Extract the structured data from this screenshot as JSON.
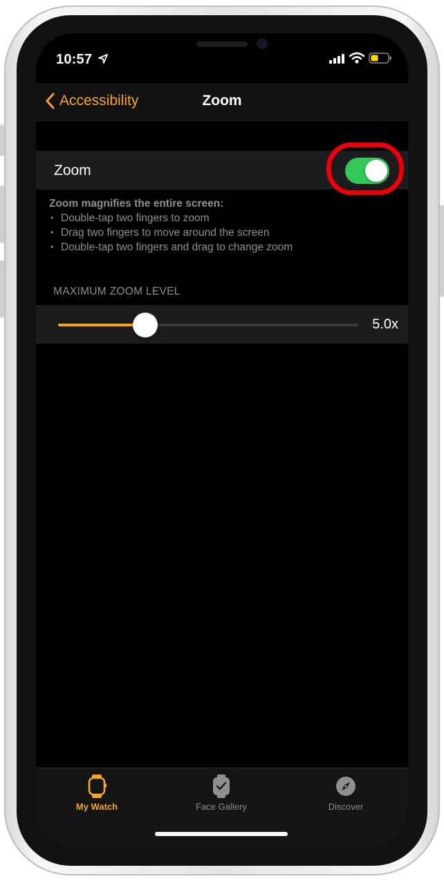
{
  "status_bar": {
    "time": "10:57",
    "icons": [
      "location-arrow-icon",
      "cellular-signal-icon",
      "wifi-icon",
      "battery-icon"
    ],
    "battery_color": "#ffd60a"
  },
  "nav": {
    "back_label": "Accessibility",
    "title": "Zoom"
  },
  "zoom_setting": {
    "label": "Zoom",
    "enabled": true,
    "toggle_color": "#34c759",
    "highlight_color": "#e8000b"
  },
  "description": {
    "heading": "Zoom magnifies the entire screen:",
    "items": [
      "Double-tap two fingers to zoom",
      "Drag two fingers to move around the screen",
      "Double-tap two fingers and drag to change zoom"
    ]
  },
  "max_zoom": {
    "header": "MAXIMUM ZOOM LEVEL",
    "value_label": "5.0x",
    "fraction": 0.29,
    "accent_color": "#f5a623"
  },
  "tab_bar": {
    "tabs": [
      {
        "label": "My Watch",
        "icon": "watch-icon",
        "active": true
      },
      {
        "label": "Face Gallery",
        "icon": "watch-face-icon",
        "active": false
      },
      {
        "label": "Discover",
        "icon": "compass-icon",
        "active": false
      }
    ],
    "active_color": "#f5a623",
    "inactive_color": "#8e8e93"
  }
}
